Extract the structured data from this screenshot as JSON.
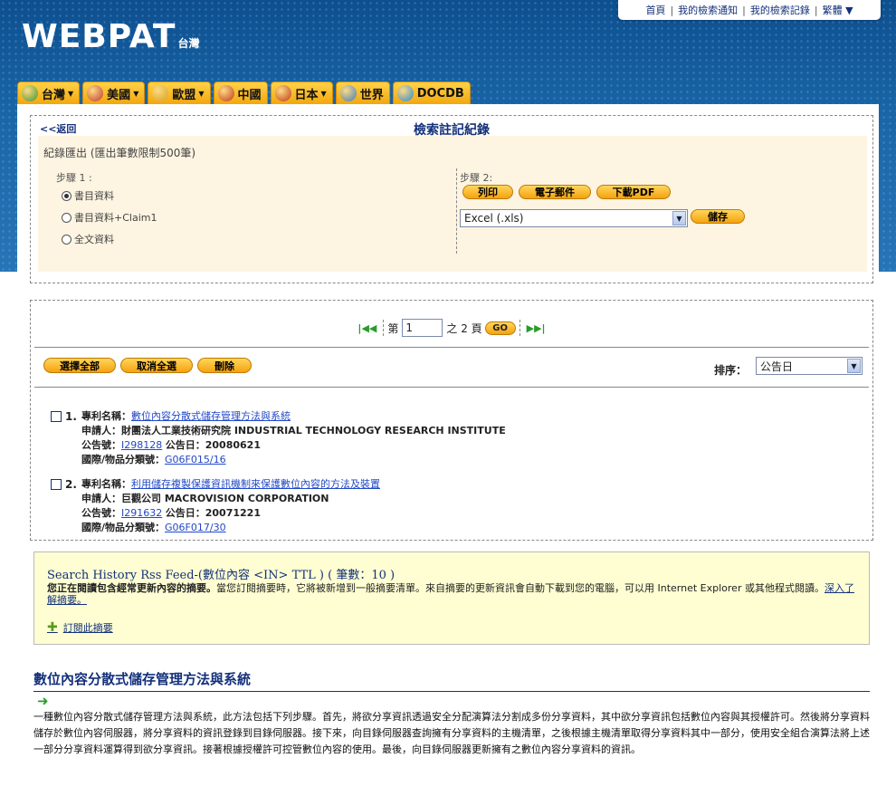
{
  "brand": {
    "logo": "WEBPAT",
    "sub": "台灣"
  },
  "topnav": {
    "home": "首頁",
    "notify": "我的檢索通知",
    "history": "我的檢索記錄",
    "lang": "繁體"
  },
  "tabs": [
    {
      "label": "台灣",
      "dropdown": true,
      "color": "#3c9a34"
    },
    {
      "label": "美國",
      "dropdown": true,
      "color": "#c13a3a"
    },
    {
      "label": "歐盟",
      "dropdown": true,
      "color": "#d9a520"
    },
    {
      "label": "中國",
      "dropdown": false,
      "color": "#c23b1f"
    },
    {
      "label": "日本",
      "dropdown": true,
      "color": "#c23b1f"
    },
    {
      "label": "世界",
      "dropdown": false,
      "color": "#3f7fc9"
    },
    {
      "label": "DOCDB",
      "dropdown": false,
      "color": "#2a8fd6"
    }
  ],
  "record": {
    "back": "<<返回",
    "title": "檢索註記紀錄",
    "export_title": "紀錄匯出 (匯出筆數限制500筆)",
    "step1": "步驟 1 :",
    "options": [
      "書目資料",
      "書目資料+Claim1",
      "全文資料"
    ],
    "selected_option": 0,
    "step2": "步驟 2:",
    "btn_print": "列印",
    "btn_email": "電子郵件",
    "btn_pdf": "下載PDF",
    "format_select": "Excel (.xls)",
    "btn_save": "儲存"
  },
  "pager": {
    "prefix": "第",
    "page": "1",
    "of": "之 2 頁",
    "go": "GO"
  },
  "actions": {
    "select_all": "選擇全部",
    "deselect_all": "取消全選",
    "delete": "刪除",
    "sort_label": "排序：",
    "sort_value": "公告日"
  },
  "results": [
    {
      "num": "1.",
      "name_label": "專利名稱：",
      "name": "數位內容分散式儲存管理方法與系統",
      "applicant_label": "申請人：",
      "applicant": "財團法人工業技術研究院 INDUSTRIAL TECHNOLOGY RESEARCH INSTITUTE",
      "pub_label": "公告號：",
      "pub": "I298128",
      "date_label": "公告日：",
      "date": "20080621",
      "ipc_label": "國際/物品分類號：",
      "ipc": "G06F015/16"
    },
    {
      "num": "2.",
      "name_label": "專利名稱：",
      "name": "利用儲存複製保護資訊機制來保護數位內容的方法及裝置",
      "applicant_label": "申請人：",
      "applicant": "巨觀公司 MACROVISION CORPORATION",
      "pub_label": "公告號：",
      "pub": "I291632",
      "date_label": "公告日：",
      "date": "20071221",
      "ipc_label": "國際/物品分類號：",
      "ipc": "G06F017/30"
    }
  ],
  "rss": {
    "title": "Search History Rss Feed-(數位內容 <IN> TTL ) ( 筆數：10 )",
    "desc_bold": "您正在閱讀包含經常更新內容的摘要。",
    "desc": "當您訂閱摘要時，它將被新增到一般摘要清單。來自摘要的更新資訊會自動下載到您的電腦，可以用 Internet Explorer 或其他程式閱讀。",
    "learn_more": "深入了解摘要。",
    "subscribe": "訂閱此摘要"
  },
  "abstract": {
    "title": "數位內容分散式儲存管理方法與系統",
    "text": "一種數位內容分散式儲存管理方法與系統，此方法包括下列步驟。首先，將欲分享資訊透過安全分配演算法分割成多份分享資料，其中欲分享資訊包括數位內容與其授權許可。然後將分享資料儲存於數位內容伺服器，將分享資料的資訊登錄到目錄伺服器。接下來，向目錄伺服器查詢擁有分享資料的主機清單，之後根據主機清單取得分享資料其中一部分，使用安全組合演算法將上述一部分分享資料運算得到欲分享資訊。接著根據授權許可控管數位內容的使用。最後，向目錄伺服器更新擁有之數位內容分享資料的資訊。"
  }
}
